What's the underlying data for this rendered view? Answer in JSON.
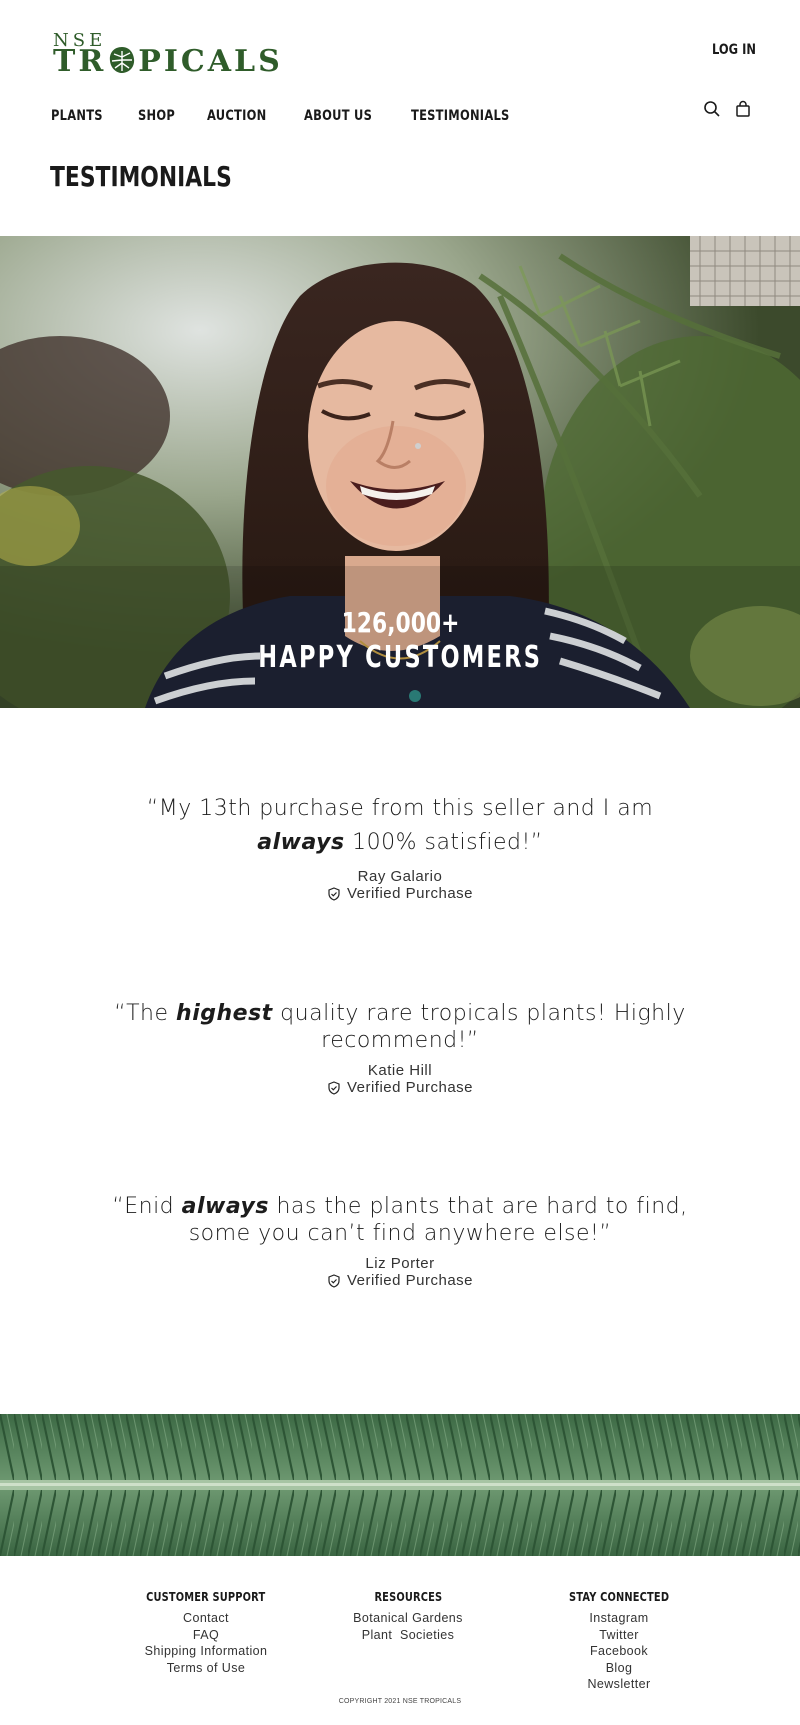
{
  "brand": {
    "logo_top": "NSE",
    "logo_main_left": "TR",
    "logo_main_right": "PICALS",
    "primary_color": "#2f5c2a"
  },
  "header": {
    "login_label": "LOG IN",
    "nav": [
      "PLANTS",
      "SHOP",
      "AUCTION",
      "ABOUT US",
      "TESTIMONIALS"
    ],
    "search_icon": "search-icon",
    "bag_icon": "shopping-bag-icon"
  },
  "page": {
    "title": "TESTIMONIALS"
  },
  "hero": {
    "count": "126,000+",
    "caption": "HAPPY CUSTOMERS"
  },
  "testimonials": [
    {
      "quote_before": "“My 13th purchase from this seller and I am",
      "quote_em": "always",
      "quote_after": " 100% satisfied!”",
      "author": "Ray Galario",
      "badge": "Verified Purchase"
    },
    {
      "quote_before": "“The ",
      "quote_em": "highest",
      "quote_after": " quality rare tropicals plants! Highly recommend!”",
      "author": "Katie Hill",
      "badge": "Verified Purchase"
    },
    {
      "quote_before": "“Enid ",
      "quote_em": "always",
      "quote_after": " has the plants that are hard to find, some you can’t find anywhere else!”",
      "author": "Liz Porter",
      "badge": "Verified Purchase"
    }
  ],
  "footer": {
    "customer_support": {
      "heading": "CUSTOMER SUPPORT",
      "links": [
        "Contact",
        "FAQ",
        "Shipping Information",
        "Terms of Use"
      ]
    },
    "resources": {
      "heading": "RESOURCES",
      "links": [
        "Botanical Gardens",
        "Plant  Societies"
      ]
    },
    "stay_connected": {
      "heading": "STAY CONNECTED",
      "links": [
        "Instagram",
        "Twitter",
        "Facebook",
        "Blog",
        "Newsletter"
      ]
    },
    "copyright": "COPYRIGHT 2021 NSE TROPICALS"
  }
}
